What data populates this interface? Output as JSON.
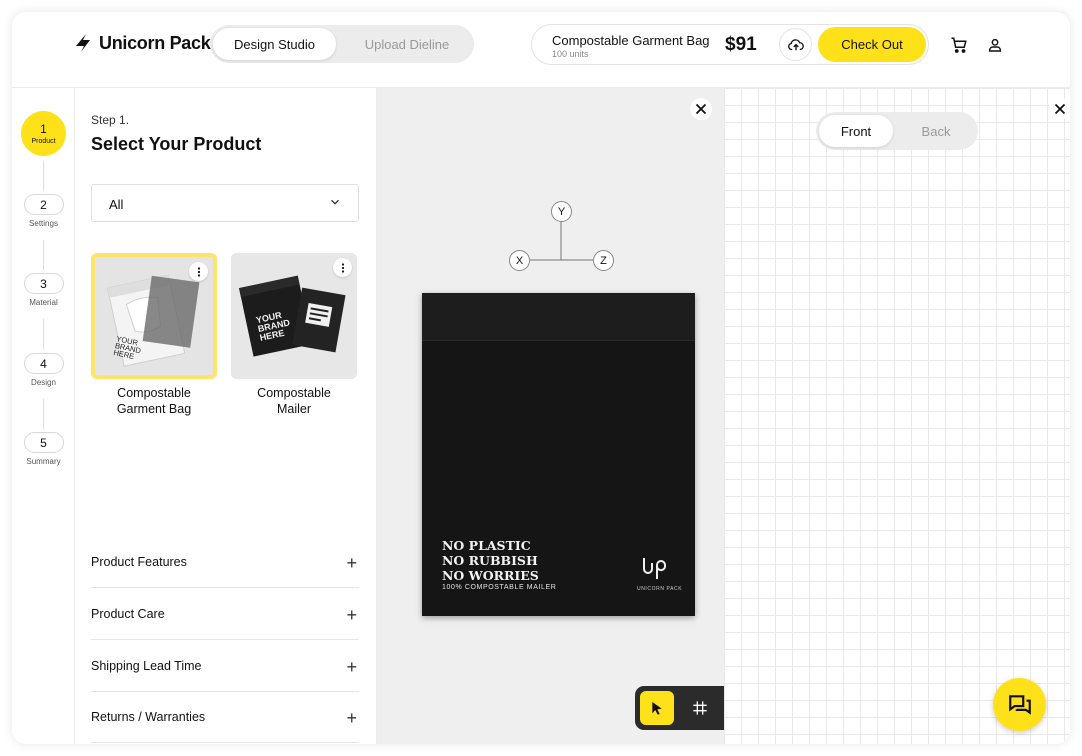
{
  "header": {
    "logo_text": "Unicorn Pack",
    "tabs": [
      {
        "label": "Design Studio",
        "active": true
      },
      {
        "label": "Upload Dieline",
        "active": false
      }
    ],
    "product": {
      "name": "Compostable Garment Bag",
      "units": "100 units",
      "price": "$91"
    },
    "checkout_label": "Check Out",
    "icons": [
      "cloud-upload-icon",
      "cart-icon",
      "user-icon"
    ]
  },
  "stepper": {
    "steps": [
      {
        "number": "1",
        "label": "Product",
        "active": true
      },
      {
        "number": "2",
        "label": "Settings",
        "active": false
      },
      {
        "number": "3",
        "label": "Material",
        "active": false
      },
      {
        "number": "4",
        "label": "Design",
        "active": false
      },
      {
        "number": "5",
        "label": "Summary",
        "active": false
      }
    ]
  },
  "panel": {
    "step_label": "Step 1.",
    "title": "Select Your Product",
    "filter": {
      "selected": "All"
    },
    "products": [
      {
        "label": "Compostable Garment Bag",
        "line1": "Compostable",
        "line2": "Garment Bag",
        "selected": true,
        "thumb_text": "YOUR BRAND HERE"
      },
      {
        "label": "Compostable Mailer",
        "line1": "Compostable",
        "line2": "Mailer",
        "selected": false,
        "thumb_text": "YOUR BRAND HERE"
      }
    ],
    "accordion": [
      {
        "label": "Product Features",
        "icon": "+"
      },
      {
        "label": "Product Care",
        "icon": "+"
      },
      {
        "label": "Shipping Lead Time",
        "icon": "+"
      },
      {
        "label": "Returns / Warranties",
        "icon": "+"
      }
    ]
  },
  "canvas": {
    "axes": {
      "y": "Y",
      "x": "X",
      "z": "Z"
    },
    "bag": {
      "lines": [
        "NO PLASTIC",
        "NO RUBBISH",
        "NO WORRIES"
      ],
      "tagline": "100% COMPOSTABLE MAILER",
      "brand": "UNICORN PACK"
    },
    "tools": [
      "pointer-icon",
      "grid-icon",
      "text-icon",
      "eye-icon"
    ]
  },
  "view": {
    "front_label": "Front",
    "back_label": "Back",
    "active": "Front"
  },
  "colors": {
    "accent": "#FFE11A",
    "bag": "#151515",
    "canvas_bg": "#efefef"
  }
}
